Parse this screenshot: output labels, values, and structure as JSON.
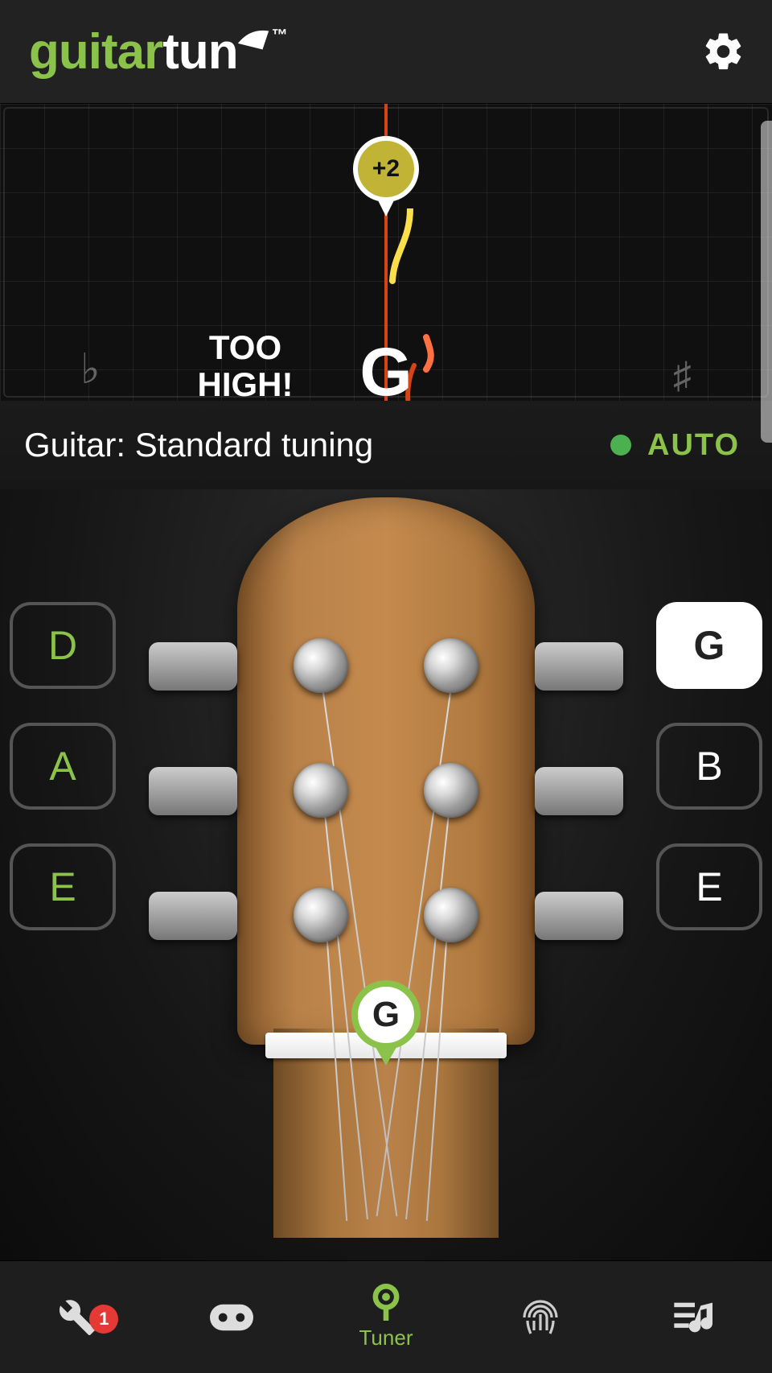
{
  "logo": {
    "part1": "guitar",
    "part2": "tun",
    "tm": "™"
  },
  "meter": {
    "offset": "+2",
    "note": "G",
    "message": "TOO HIGH!",
    "flat": "♭",
    "sharp": "♯"
  },
  "tuning": {
    "label": "Guitar: Standard tuning",
    "auto": "AUTO"
  },
  "strings": {
    "left": [
      "D",
      "A",
      "E"
    ],
    "right": [
      "G",
      "B",
      "E"
    ],
    "active": "G",
    "current_pin": "G"
  },
  "nav": {
    "badge": "1",
    "active_label": "Tuner"
  }
}
